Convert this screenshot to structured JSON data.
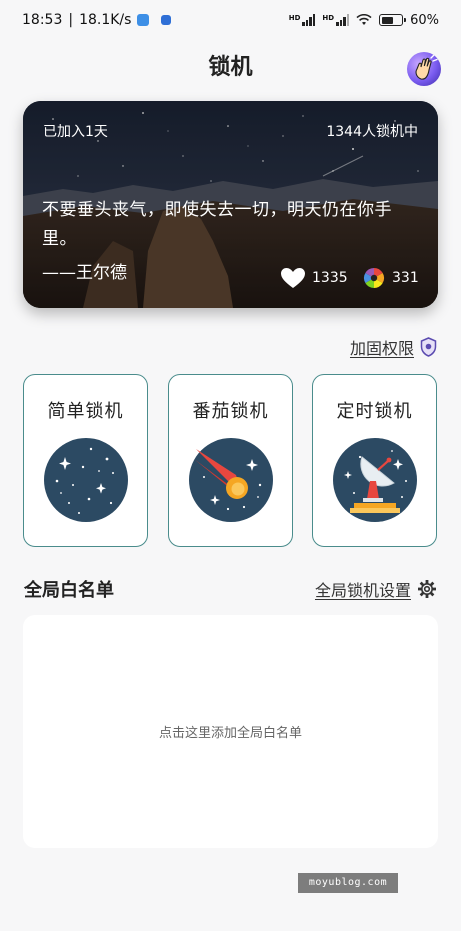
{
  "status_bar": {
    "time": "18:53",
    "speed": "18.1K/s",
    "battery": "60%",
    "battery_level": 0.6
  },
  "header": {
    "title": "锁机"
  },
  "quote_card": {
    "joined_text": "已加入1天",
    "locked_count_text": "1344人锁机中",
    "quote": "不要垂头丧气，即使失去一切，明天仍在你手里。",
    "author": "——王尔德",
    "likes": "1335",
    "shares": "331"
  },
  "reinforce": {
    "label": "加固权限"
  },
  "modes": [
    {
      "label": "简单锁机",
      "icon": "stars-icon"
    },
    {
      "label": "番茄锁机",
      "icon": "comet-icon"
    },
    {
      "label": "定时锁机",
      "icon": "satellite-dish-icon"
    }
  ],
  "whitelist": {
    "title": "全局白名单",
    "settings_label": "全局锁机设置",
    "empty_hint": "点击这里添加全局白名单"
  },
  "watermark": "moyublog.com",
  "colors": {
    "card_border": "#4a8c8c",
    "icon_circle": "#2c4a63",
    "background": "#f7f7f8"
  }
}
